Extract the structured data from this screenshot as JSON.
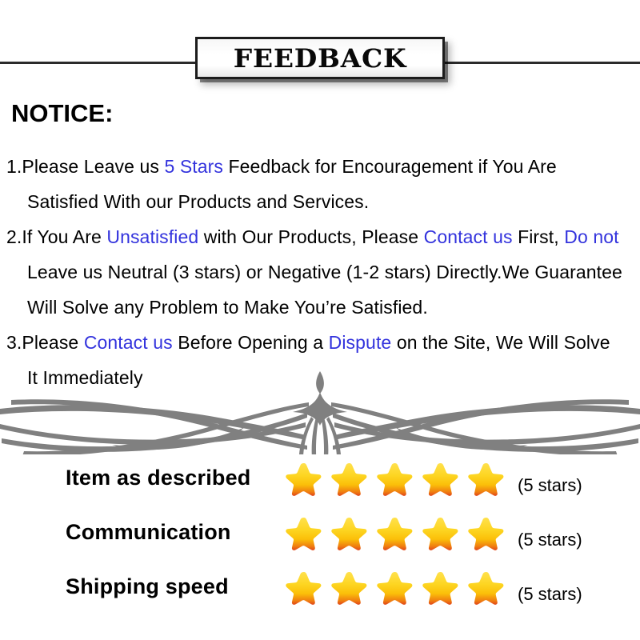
{
  "banner": {
    "title": "FEEDBACK"
  },
  "notice": {
    "heading": "NOTICE:",
    "lines": [
      {
        "indent": false,
        "segments": [
          {
            "text": "1.Please Leave us  ",
            "highlight": false
          },
          {
            "text": "5 Stars",
            "highlight": true
          },
          {
            "text": "  Feedback for  Encouragement  if You Are",
            "highlight": false
          }
        ]
      },
      {
        "indent": true,
        "segments": [
          {
            "text": "Satisfied With our Products and Services.",
            "highlight": false
          }
        ]
      },
      {
        "indent": false,
        "segments": [
          {
            "text": "2.If You Are ",
            "highlight": false
          },
          {
            "text": "Unsatisfied",
            "highlight": true
          },
          {
            "text": " with Our Products, Please ",
            "highlight": false
          },
          {
            "text": "Contact us",
            "highlight": true
          },
          {
            "text": " First, ",
            "highlight": false
          },
          {
            "text": "Do not",
            "highlight": true
          }
        ]
      },
      {
        "indent": true,
        "segments": [
          {
            "text": "Leave us Neutral (3 stars) or Negative (1-2 stars) Directly.We Guarantee",
            "highlight": false
          }
        ]
      },
      {
        "indent": true,
        "segments": [
          {
            "text": "Will Solve any Problem to Make You’re  Satisfied.",
            "highlight": false
          }
        ]
      },
      {
        "indent": false,
        "segments": [
          {
            "text": "3.Please ",
            "highlight": false
          },
          {
            "text": "Contact us",
            "highlight": true
          },
          {
            "text": " Before Opening a ",
            "highlight": false
          },
          {
            "text": "Dispute",
            "highlight": true
          },
          {
            "text": " on the Site, We Will Solve",
            "highlight": false
          }
        ]
      },
      {
        "indent": true,
        "segments": [
          {
            "text": "It Immediately",
            "highlight": false
          }
        ]
      }
    ]
  },
  "divider": {
    "icon": "filigree-flourish-ornament",
    "color": "#808080"
  },
  "ratings": {
    "rows": [
      {
        "label": "Item as described",
        "stars": 5,
        "count_text": "(5 stars)"
      },
      {
        "label": "Communication",
        "stars": 5,
        "count_text": "(5 stars)"
      },
      {
        "label": "Shipping speed",
        "stars": 5,
        "count_text": "(5 stars)"
      }
    ],
    "star_colors": {
      "top": "#ffe14d",
      "mid": "#fbbf09",
      "bottom": "#ef7d10",
      "edge": "#e0451c"
    }
  },
  "colors": {
    "highlight_blue": "#3333dd",
    "text_black": "#000000",
    "rule_black": "#2b2b2b",
    "ornament_gray": "#808080",
    "background": "#ffffff"
  }
}
